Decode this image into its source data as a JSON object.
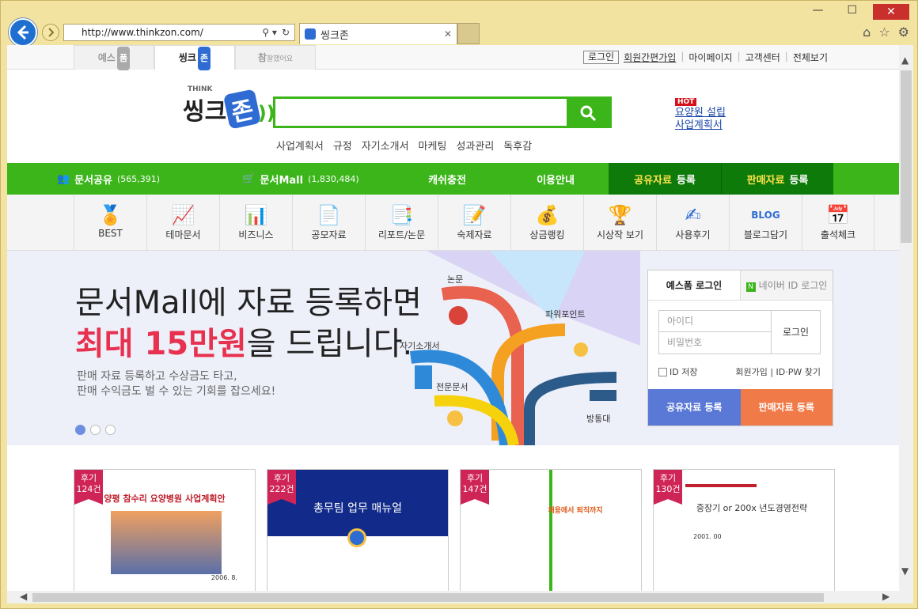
{
  "browser": {
    "url": "http://www.thinkzon.com/",
    "tab_title": "씽크존",
    "window_controls": {
      "minimize": "—",
      "maximize": "☐",
      "close": "✕"
    }
  },
  "site": {
    "site_tabs": [
      {
        "label": "예스",
        "badge": "폼"
      },
      {
        "label": "씽크",
        "badge": "존"
      },
      {
        "label": "참",
        "badge": "잘했어요"
      }
    ],
    "top_links": {
      "login": "로그인",
      "join": "회원간편가입",
      "mypage": "마이페이지",
      "support": "고객센터",
      "all": "전체보기"
    },
    "logo": {
      "think": "THINK",
      "main": "씽크",
      "zon": "존"
    },
    "search": {
      "value": ""
    },
    "keywords": [
      "사업계획서",
      "규정",
      "자기소개서",
      "마케팅",
      "성과관리",
      "독후감"
    ],
    "hot": {
      "badge": "HOT",
      "link1": "요양원 설립",
      "link2": "사업계획서"
    },
    "gnav": {
      "share": {
        "label": "문서공유",
        "count": "(565,391)"
      },
      "mall": {
        "label": "문서Mall",
        "count": "(1,830,484)"
      },
      "charge": "캐쉬충전",
      "guide": "이용안내",
      "share_reg": {
        "a": "공유자료",
        "b": "등록"
      },
      "sale_reg": {
        "a": "판매자료",
        "b": "등록"
      }
    },
    "categories": [
      {
        "label": "BEST",
        "icon": "medal-icon"
      },
      {
        "label": "테마문서",
        "icon": "chart-board-icon"
      },
      {
        "label": "비즈니스",
        "icon": "bar-chart-icon"
      },
      {
        "label": "공모자료",
        "icon": "document-star-icon"
      },
      {
        "label": "리포트/논문",
        "icon": "report-clock-icon"
      },
      {
        "label": "숙제자료",
        "icon": "pencil-doc-icon"
      },
      {
        "label": "상금랭킹",
        "icon": "money-icon"
      },
      {
        "label": "시상작 보기",
        "icon": "trophy-icon"
      },
      {
        "label": "사용후기",
        "icon": "handwriting-icon"
      },
      {
        "label": "블로그담기",
        "icon": "blog-icon"
      },
      {
        "label": "출석체크",
        "icon": "calendar-icon"
      }
    ],
    "banner": {
      "line1": "문서Mall에 자료 등록하면",
      "line2_red": "최대 15만원",
      "line2_rest": "을 드립니다.",
      "sub1": "판매 자료 등록하고 수상금도 타고,",
      "sub2": "판매 수익금도 벌 수 있는 기회를 잡으세요!",
      "tree_labels": {
        "paper": "논문",
        "ppt": "파워포인트",
        "intro": "자기소개서",
        "expert": "전문문서",
        "cyber": "방통대"
      }
    },
    "login": {
      "tab_yesform": "예스폼 로그인",
      "tab_naver_badge": "N",
      "tab_naver": "네이버 ID 로그인",
      "id_placeholder": "아이디",
      "pw_placeholder": "비밀번호",
      "button": "로그인",
      "save_id": "ID 저장",
      "join_find": "회원가입 | ID·PW 찾기",
      "share_btn": "공유자료 등록",
      "sale_btn": "판매자료 등록"
    },
    "docs": [
      {
        "ribbon_a": "후기",
        "ribbon_b": "124건",
        "title": "양평 참수리 요양병원 사업계획안",
        "foot": "2006. 8."
      },
      {
        "ribbon_a": "후기",
        "ribbon_b": "222건",
        "title": "총무팀 업무 매뉴얼",
        "foot": ""
      },
      {
        "ribbon_a": "후기",
        "ribbon_b": "147건",
        "title": "채용에서 퇴직까지",
        "foot": ""
      },
      {
        "ribbon_a": "후기",
        "ribbon_b": "130건",
        "title": "중장기 or 200x 년도경영전략",
        "foot": "2001. 00"
      }
    ]
  }
}
